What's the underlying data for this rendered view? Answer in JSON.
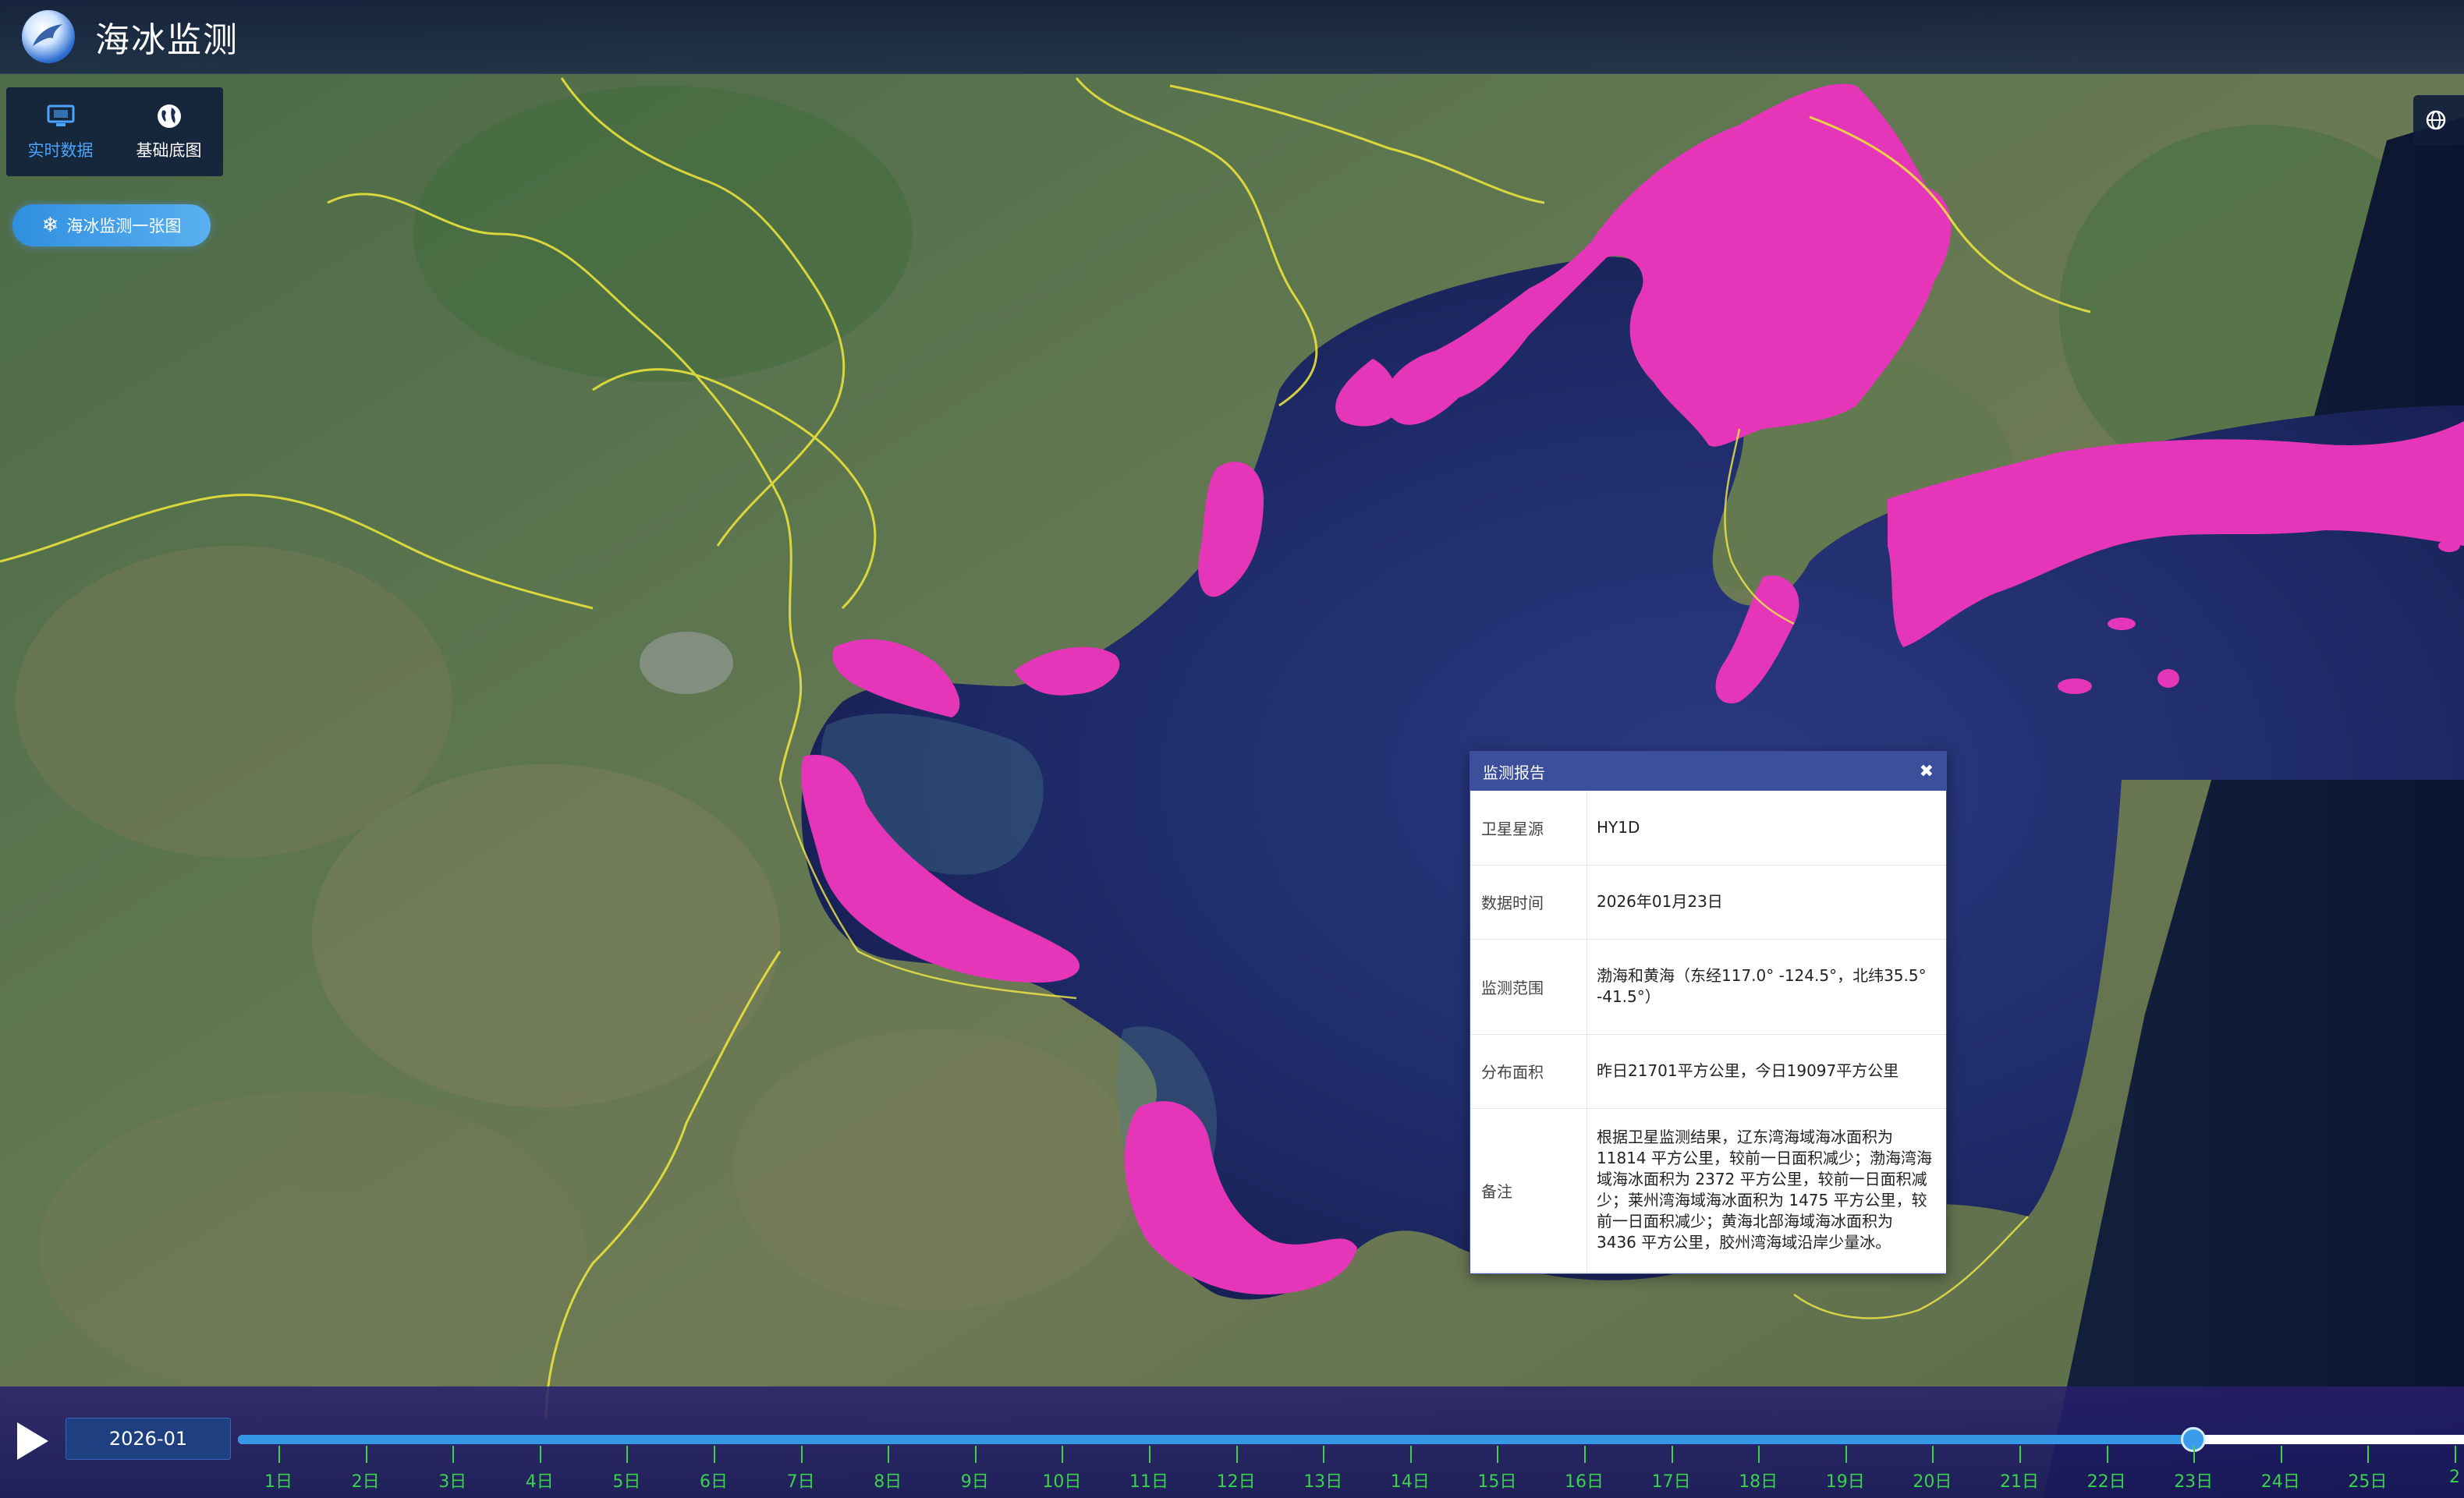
{
  "header": {
    "title": "海冰监测",
    "logo_icon": "sea-ice-logo"
  },
  "tools": [
    {
      "label": "实时数据",
      "icon": "monitor-icon",
      "active": true
    },
    {
      "label": "基础底图",
      "icon": "globe-icon",
      "active": false
    }
  ],
  "sea_ice_button": {
    "label": "海冰监测一张图",
    "icon": "snowflake-icon"
  },
  "map": {
    "ice_color": "#e536b9",
    "boundary_color": "#e8e23c",
    "sea_color": "#1d2560"
  },
  "report": {
    "title": "监测报告",
    "rows": [
      {
        "key": "卫星星源",
        "value": "HY1D"
      },
      {
        "key": "数据时间",
        "value": "2026年01月23日"
      },
      {
        "key": "监测范围",
        "value": "渤海和黄海（东经117.0° -124.5°，北纬35.5° -41.5°）"
      },
      {
        "key": "分布面积",
        "value": "昨日21701平方公里，今日19097平方公里"
      },
      {
        "key": "备注",
        "value": "根据卫星监测结果，辽东湾海域海冰面积为 11814 平方公里，较前一日面积减少；渤海湾海域海冰面积为 2372 平方公里，较前一日面积减少；莱州湾海域海冰面积为 1475 平方公里，较前一日面积减少；黄海北部海域海冰面积为 3436 平方公里，胶州湾海域沿岸少量冰。"
      }
    ]
  },
  "timeline": {
    "month": "2026-01",
    "selected_day": 23,
    "total_days": 31,
    "day_labels": [
      "1日",
      "2日",
      "3日",
      "4日",
      "5日",
      "6日",
      "7日",
      "8日",
      "9日",
      "10日",
      "11日",
      "12日",
      "13日",
      "14日",
      "15日",
      "16日",
      "17日",
      "18日",
      "19日",
      "20日",
      "21日",
      "22日",
      "23日",
      "24日",
      "25日",
      "2"
    ]
  }
}
